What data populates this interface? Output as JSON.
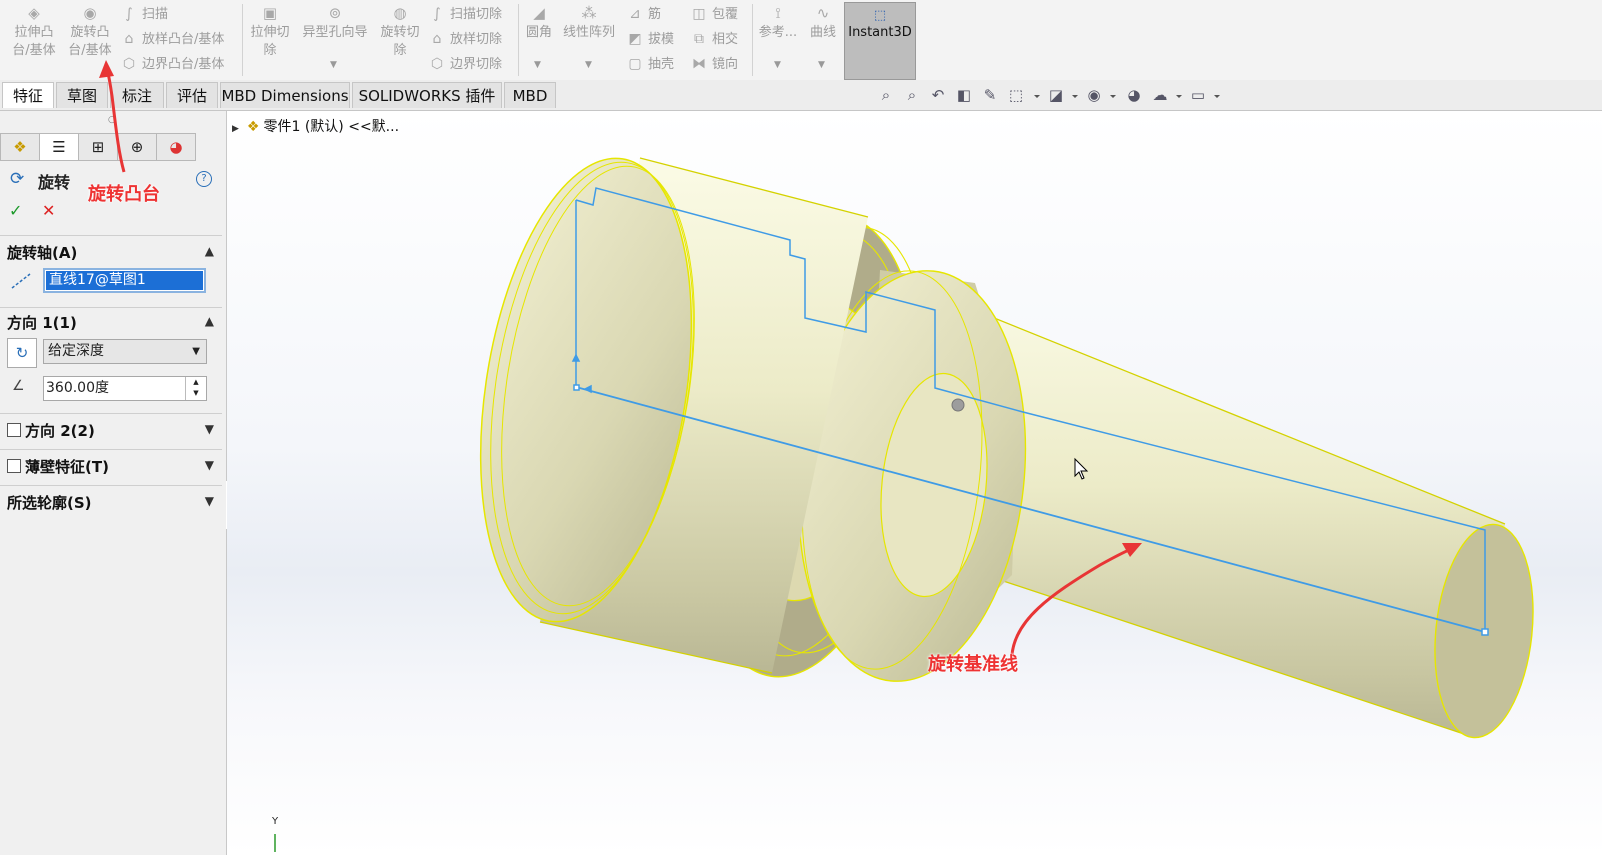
{
  "ribbon": {
    "big1": {
      "label": [
        "拉伸凸",
        "台/基体"
      ],
      "icon": "extruded-boss-icon"
    },
    "big2": {
      "label": [
        "旋转凸",
        "台/基体"
      ],
      "icon": "revolved-boss-icon"
    },
    "small1": [
      "扫描",
      "放样凸台/基体",
      "边界凸台/基体"
    ],
    "big3": {
      "label": [
        "拉伸切",
        "除"
      ],
      "icon": "extruded-cut-icon"
    },
    "big4": {
      "label": [
        "异型孔向导"
      ],
      "icon": "hole-wizard-icon"
    },
    "big5": {
      "label": [
        "旋转切",
        "除"
      ],
      "icon": "revolved-cut-icon"
    },
    "small2": [
      "扫描切除",
      "放样切除",
      "边界切除"
    ],
    "big6": {
      "label": [
        "圆角"
      ],
      "icon": "fillet-icon"
    },
    "big7": {
      "label": [
        "线性阵列"
      ],
      "icon": "linear-pattern-icon"
    },
    "small3": [
      "筋",
      "拔模",
      "抽壳"
    ],
    "small4": [
      "包覆",
      "相交",
      "镜向"
    ],
    "big8": {
      "label": [
        "参考..."
      ],
      "icon": "reference-geometry-icon"
    },
    "big9": {
      "label": [
        "曲线"
      ],
      "icon": "curves-icon"
    },
    "instant3d": "Instant3D"
  },
  "tabs": [
    "特征",
    "草图",
    "标注",
    "评估",
    "MBD Dimensions",
    "SOLIDWORKS 插件",
    "MBD"
  ],
  "tree": {
    "label": "零件1 (默认) <<默..."
  },
  "panel": {
    "title": "旋转",
    "help": "?",
    "ok": "✓",
    "cancel": "✕",
    "axis": {
      "header": "旋转轴(A)",
      "value": "直线17@草图1"
    },
    "dir1": {
      "header": "方向 1(1)",
      "type": "给定深度",
      "angle": "360.00度"
    },
    "dir2": {
      "header": "方向 2(2)"
    },
    "thin": {
      "header": "薄壁特征(T)"
    },
    "contours": {
      "header": "所选轮廓(S)"
    }
  },
  "annotations": {
    "boss": "旋转凸台",
    "axisline": "旋转基准线"
  },
  "triad": {
    "y": "Y"
  },
  "colors": {
    "annotation": "#e83535",
    "part_fill": "#ecebc6",
    "part_edge": "#e6e600",
    "sketch_line": "#3f9be6",
    "instant3d_bg": "#bdbdbd"
  }
}
